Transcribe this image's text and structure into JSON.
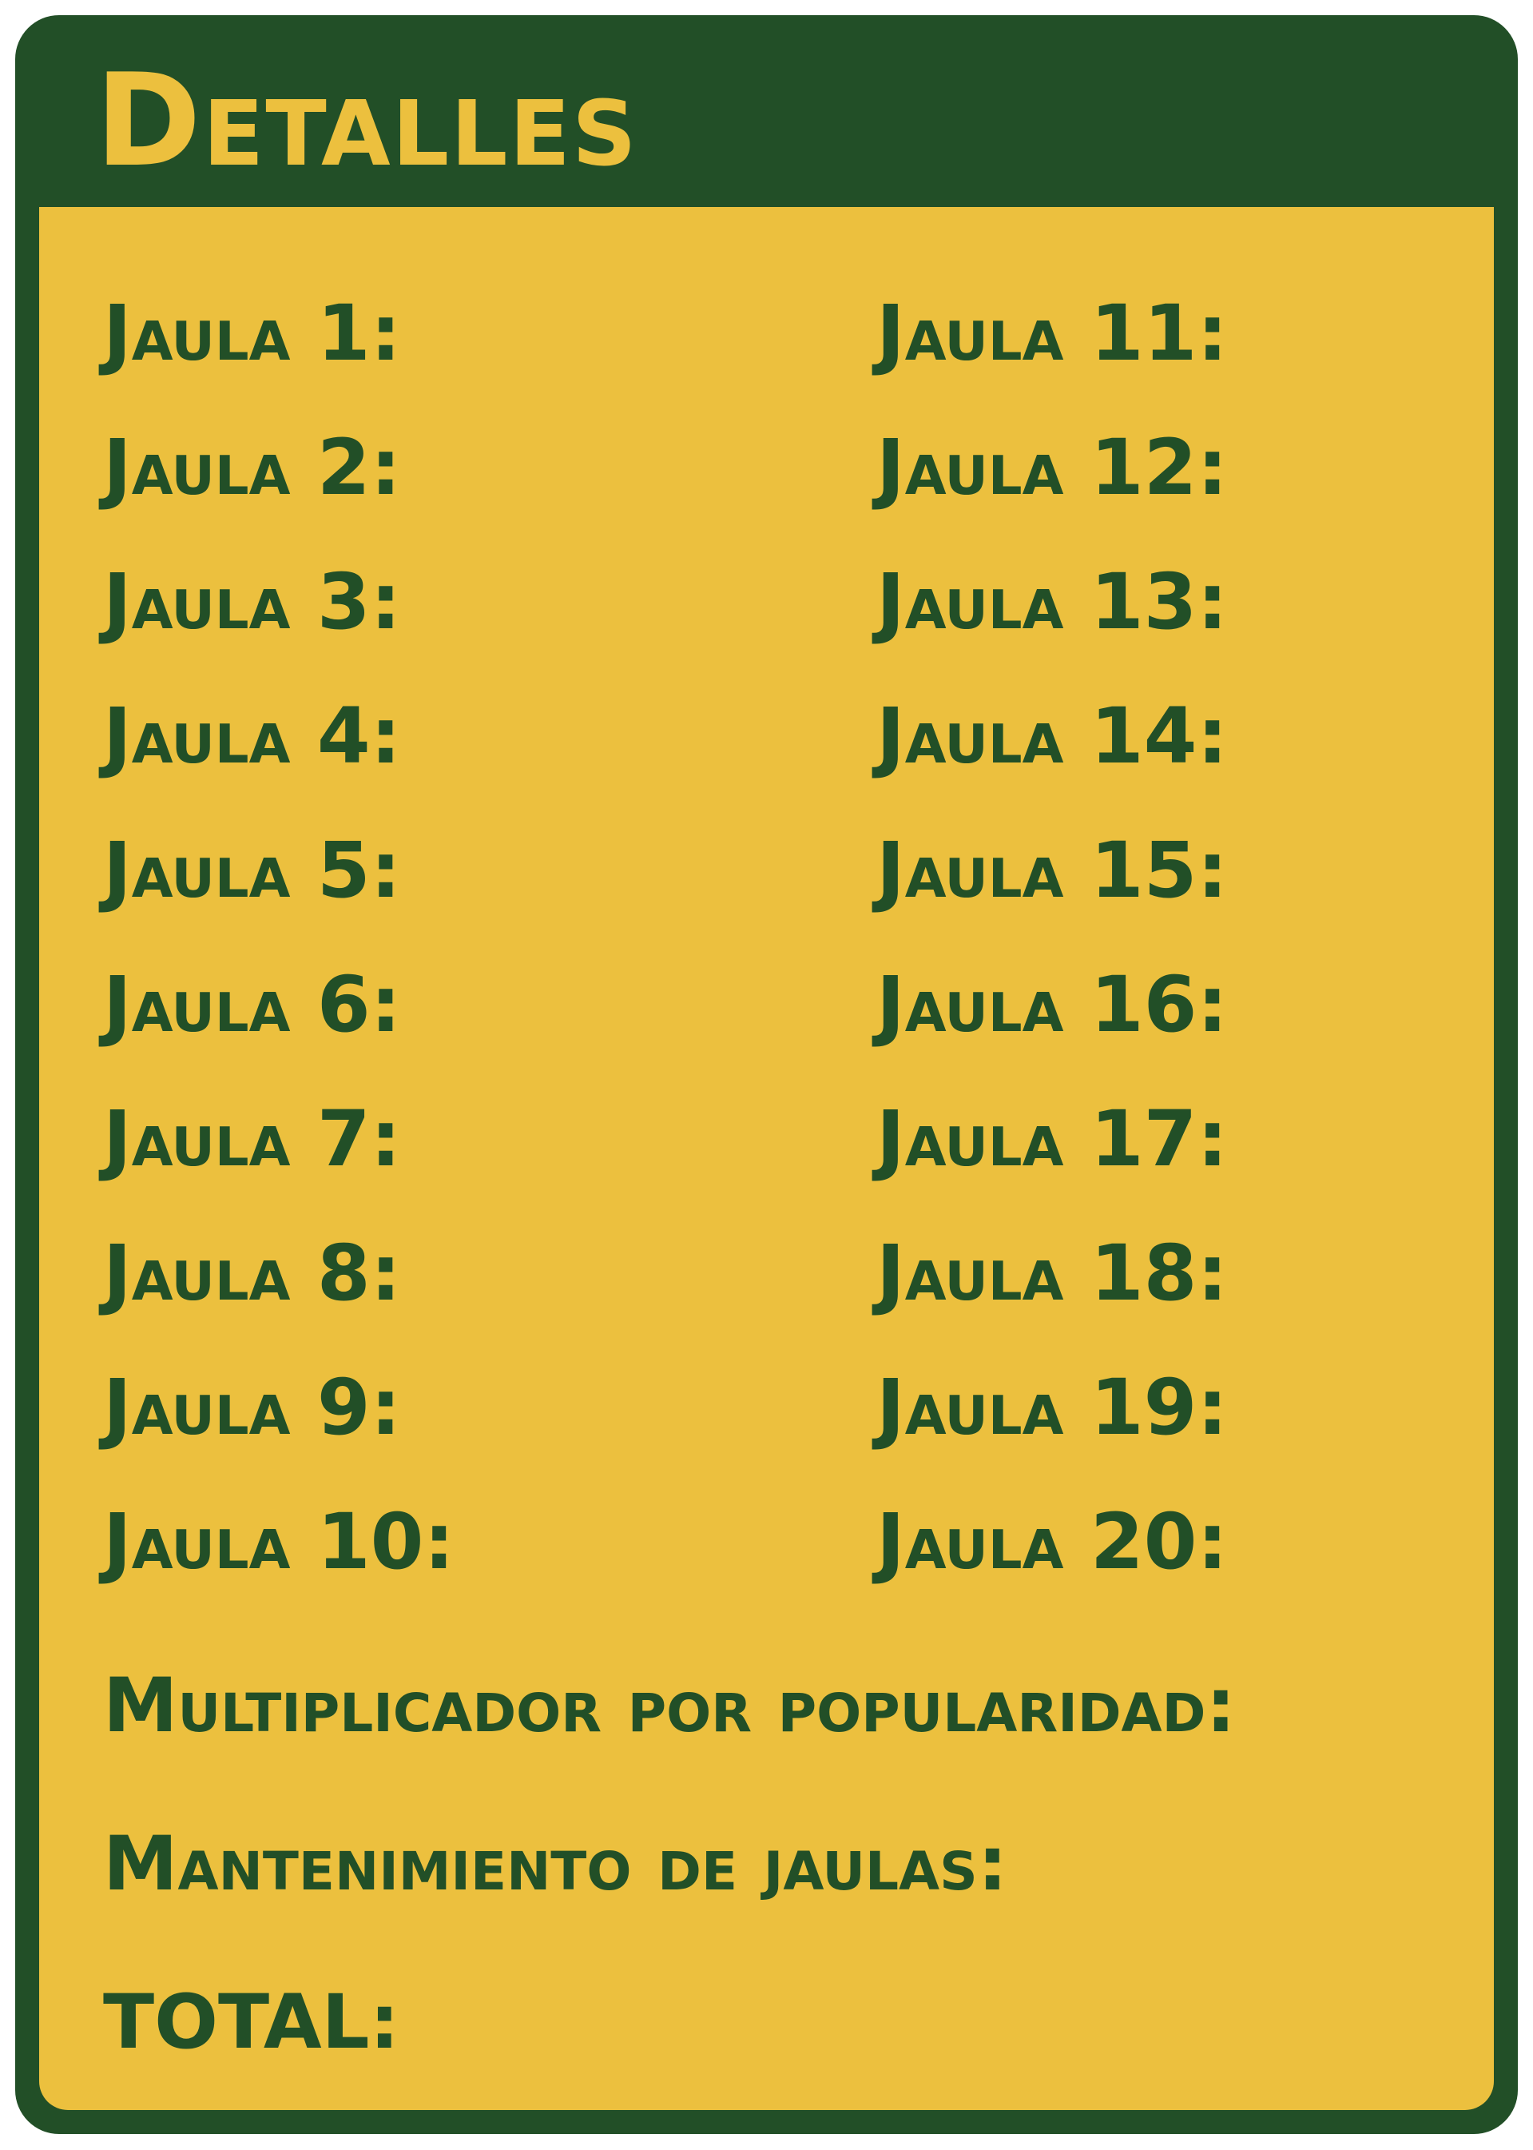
{
  "title": "Detalles",
  "colors": {
    "frame": "#224f27",
    "panel": "#ecc03e",
    "title_text": "#ecc03e",
    "body_text": "#224f27"
  },
  "cages_left": [
    "Jaula 1:",
    "Jaula 2:",
    "Jaula 3:",
    "Jaula 4:",
    "Jaula 5:",
    "Jaula 6:",
    "Jaula 7:",
    "Jaula 8:",
    "Jaula 9:",
    "Jaula 10:"
  ],
  "cages_right": [
    "Jaula 11:",
    "Jaula 12:",
    "Jaula 13:",
    "Jaula 14:",
    "Jaula 15:",
    "Jaula 16:",
    "Jaula 17:",
    "Jaula 18:",
    "Jaula 19:",
    "Jaula 20:"
  ],
  "summary": {
    "popularity_multiplier": "Multiplicador por popularidad:",
    "cage_maintenance": "Mantenimiento de jaulas:",
    "total": "TOTAL:"
  }
}
